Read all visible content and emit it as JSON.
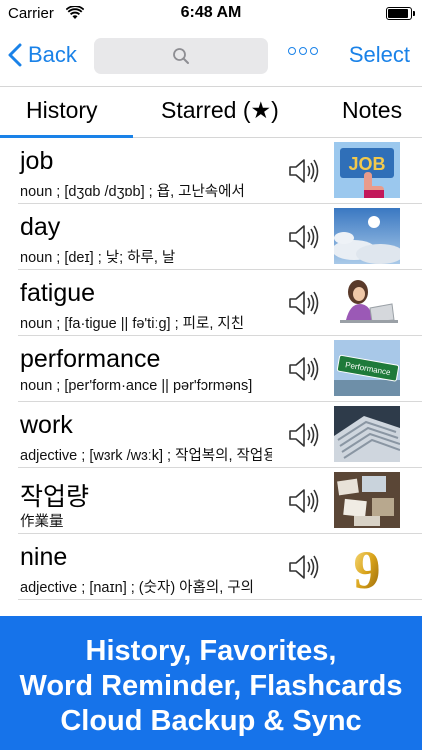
{
  "status": {
    "carrier": "Carrier",
    "time": "6:48 AM"
  },
  "nav": {
    "back_label": "Back",
    "search_placeholder": "",
    "select_label": "Select"
  },
  "tabs": [
    {
      "label": "History",
      "active": true
    },
    {
      "label": "Starred (★)",
      "active": false
    },
    {
      "label": "Notes",
      "active": false
    }
  ],
  "entries": [
    {
      "word": "job",
      "definition": "noun ; [dʒɑb /dʒɒb] ; 욥, 고난속에서",
      "image": "job-sign-image"
    },
    {
      "word": "day",
      "definition": "noun ; [deɪ] ; 낮; 하루, 날",
      "image": "sky-clouds-image"
    },
    {
      "word": "fatigue",
      "definition": "noun ; [fa·tigue || fə'tiːg] ; 피로, 지친",
      "image": "tired-woman-laptop-image"
    },
    {
      "word": "performance",
      "definition": "noun ; [per'form·ance || pər'fɔrməns]",
      "image": "performance-road-sign-image"
    },
    {
      "word": "work",
      "definition": "adjective ; [wɜrk /wɜːk] ; 작업복의, 작업용의",
      "image": "paper-stacks-image"
    },
    {
      "word": "작업량",
      "definition": "作業量",
      "image": "cluttered-desk-image"
    },
    {
      "word": "nine",
      "definition": "adjective ; [naɪn] ; (숫자) 아홉의, 구의",
      "image": "gold-number-nine-image"
    }
  ],
  "banner": {
    "line1": "History, Favorites,",
    "line2": "Word Reminder, Flashcards",
    "line3": "Cloud Backup & Sync"
  },
  "colors": {
    "accent": "#1a82e8",
    "banner": "#1673ea"
  }
}
